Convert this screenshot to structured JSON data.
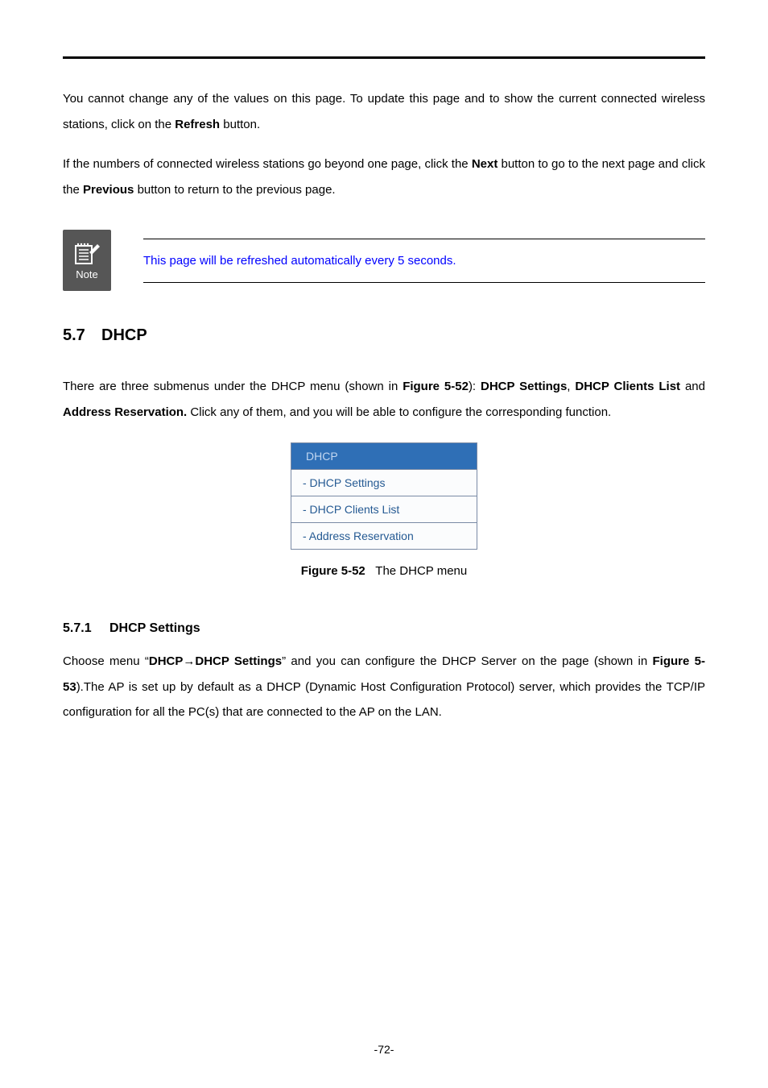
{
  "intro": {
    "p1_pre": "You cannot change any of the values on this page. To update this page and to show the current connected wireless stations, click on the ",
    "p1_b1": "Refresh",
    "p1_post": " button.",
    "p2_pre": "If the numbers of connected wireless stations go beyond one page, click the ",
    "p2_b1": "Next",
    "p2_mid": " button to go to the next page and click the ",
    "p2_b2": "Previous",
    "p2_post": " button to return to the previous page."
  },
  "note": {
    "icon_label": "Note",
    "text": "This page will be refreshed automatically every 5 seconds."
  },
  "section": {
    "num": "5.7",
    "title": "DHCP",
    "para_pre": "There are three submenus under the DHCP menu (shown in ",
    "para_b1": "Figure 5-52",
    "para_mid1": "): ",
    "para_b2": "DHCP Settings",
    "para_mid2": ", ",
    "para_b3": "DHCP Clients List",
    "para_mid3": " and ",
    "para_b4": "Address Reservation.",
    "para_post": " Click any of them, and you will be able to configure the corresponding function."
  },
  "menu": {
    "header": "DHCP",
    "items": [
      "- DHCP Settings",
      "- DHCP Clients List",
      "- Address Reservation"
    ]
  },
  "caption": {
    "label": "Figure 5-52",
    "text": "The DHCP menu"
  },
  "subsection": {
    "num": "5.7.1",
    "title": "DHCP Settings",
    "p_pre": "Choose menu “",
    "p_b1": "DHCP",
    "p_arrow": "→",
    "p_b2": "DHCP Settings",
    "p_mid1": "” and you can configure the DHCP Server on the page (shown in ",
    "p_b3": "Figure 5-53",
    "p_post": ").The AP is set up by default as a DHCP (Dynamic Host Configuration Protocol) server, which provides the TCP/IP configuration for all the PC(s) that are connected to the AP on the LAN."
  },
  "footer": "-72-"
}
